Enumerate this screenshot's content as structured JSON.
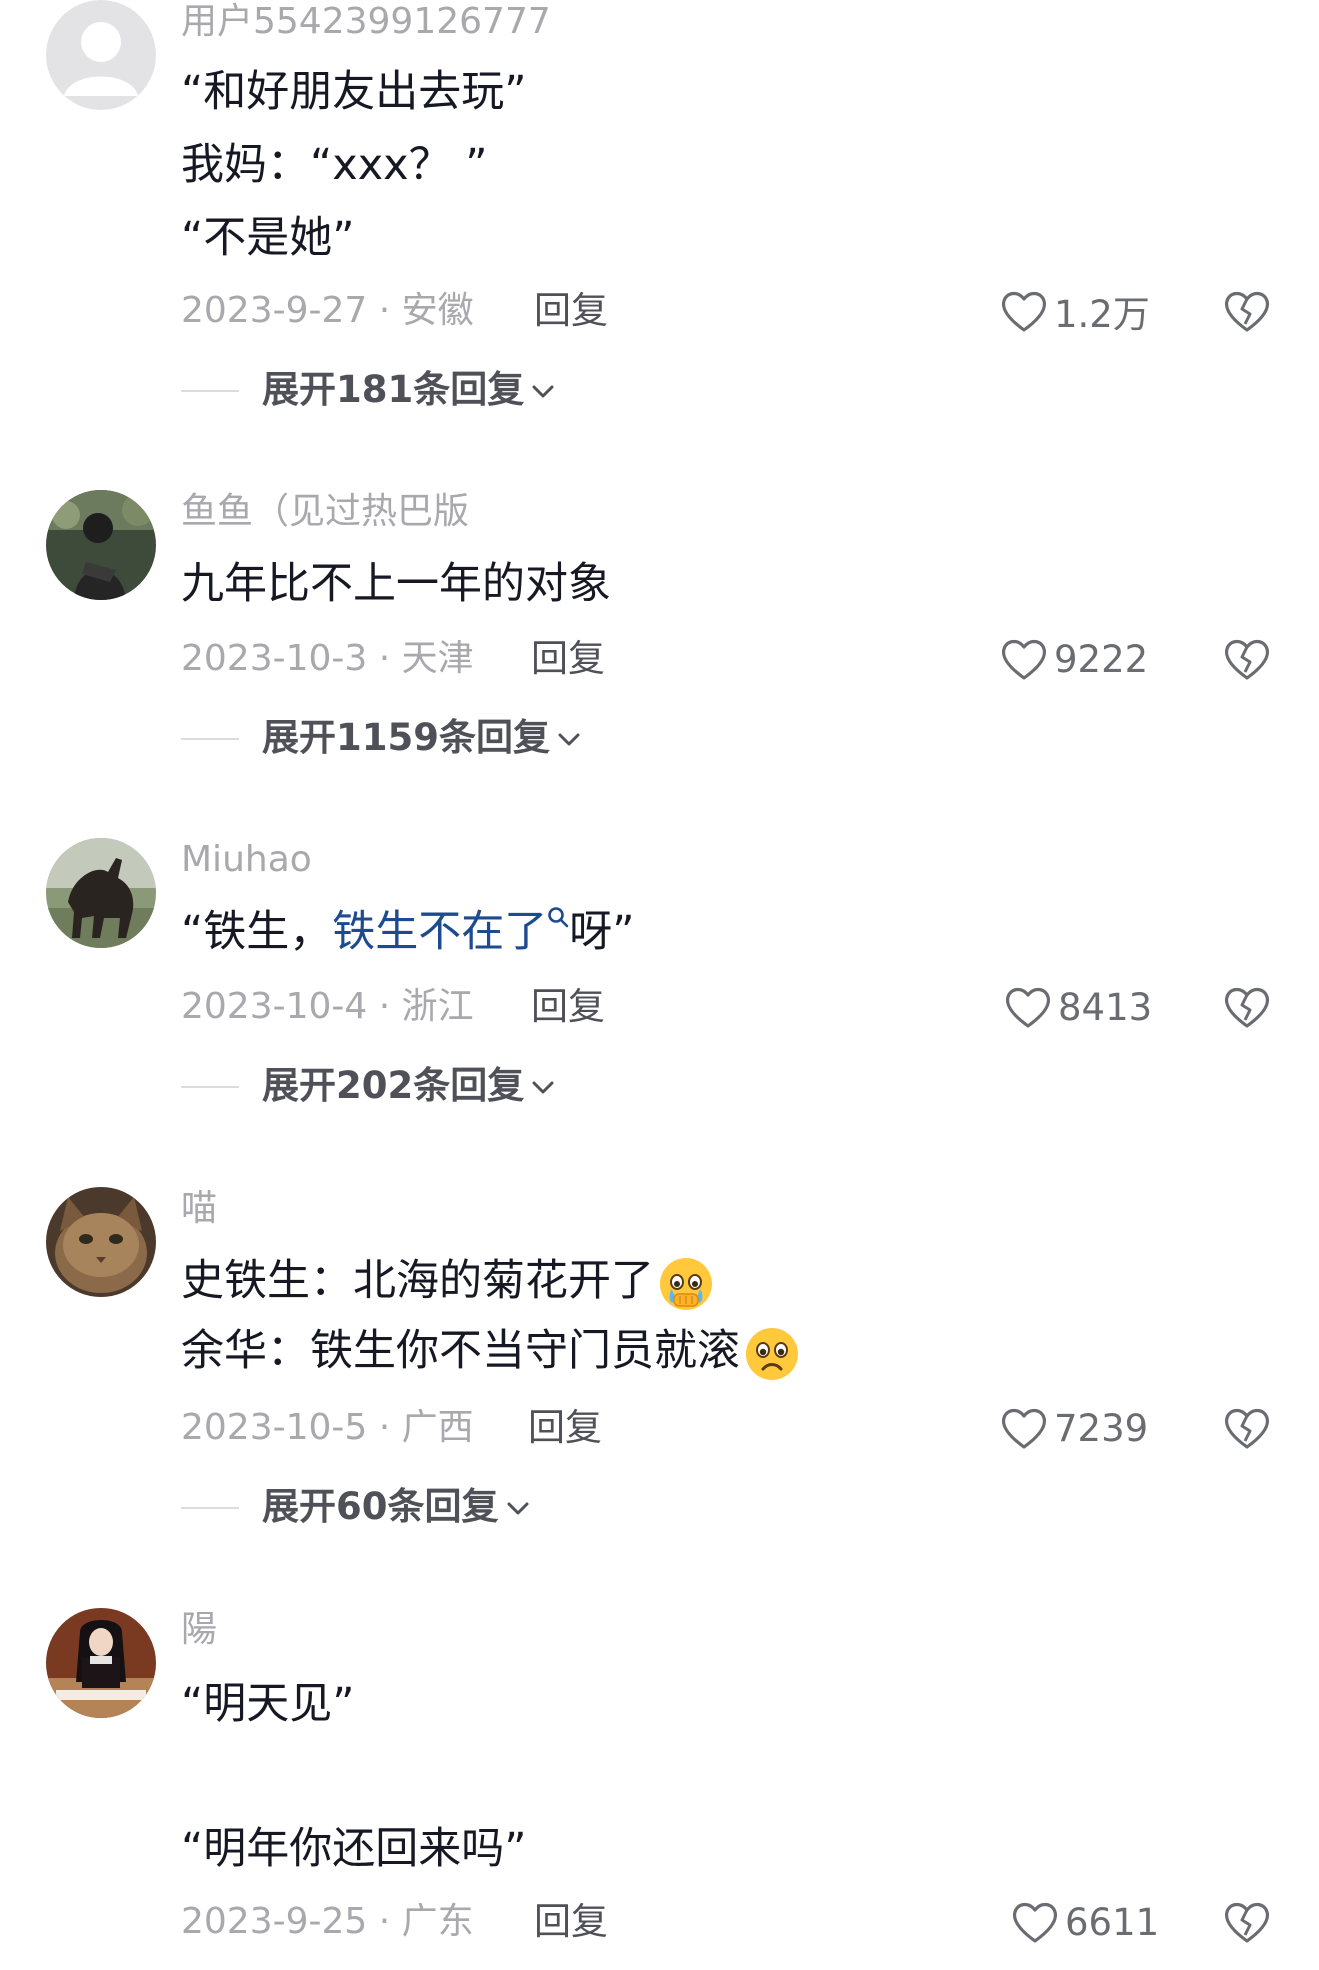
{
  "colors": {
    "username": "#a8a8ad",
    "text": "#161823",
    "link": "#1d4b8f",
    "meta": "#a8a8ad",
    "action": "#505158"
  },
  "comments": [
    {
      "username": "用户5542399126777",
      "lines": [
        "“和好朋友出去玩”",
        "我妈：“xxx？ ”",
        "“不是她”"
      ],
      "date_location": "2023-9-27 · 安徽",
      "reply_label": "回复",
      "likes": "1.2万",
      "expand": "展开181条回复",
      "avatar_icon": "default-avatar-icon"
    },
    {
      "username": "鱼鱼（见过热巴版",
      "lines": [
        "九年比不上一年的对象"
      ],
      "date_location": "2023-10-3 · 天津",
      "reply_label": "回复",
      "likes": "9222",
      "expand": "展开1159条回复",
      "avatar_icon": "photo-avatar-icon"
    },
    {
      "username": "Miuhao",
      "line_prefix": "“铁生，",
      "line_link": "铁生不在了",
      "line_suffix": "呀”",
      "date_location": "2023-10-4 · 浙江",
      "reply_label": "回复",
      "likes": "8413",
      "expand": "展开202条回复",
      "avatar_icon": "horse-avatar-icon"
    },
    {
      "username": "喵",
      "lines": [
        "史铁生：北海的菊花开了",
        "余华：铁生你不当守门员就滚"
      ],
      "emojis": [
        "crying-emoji-icon",
        "sad-emoji-icon"
      ],
      "date_location": "2023-10-5 · 广西",
      "reply_label": "回复",
      "likes": "7239",
      "expand": "展开60条回复",
      "avatar_icon": "cat-avatar-icon"
    },
    {
      "username": "陽",
      "lines": [
        "“明天见”",
        "“明年你还回来吗”"
      ],
      "date_location": "2023-9-25 · 广东",
      "reply_label": "回复",
      "likes": "6611",
      "avatar_icon": "girl-avatar-icon"
    }
  ]
}
